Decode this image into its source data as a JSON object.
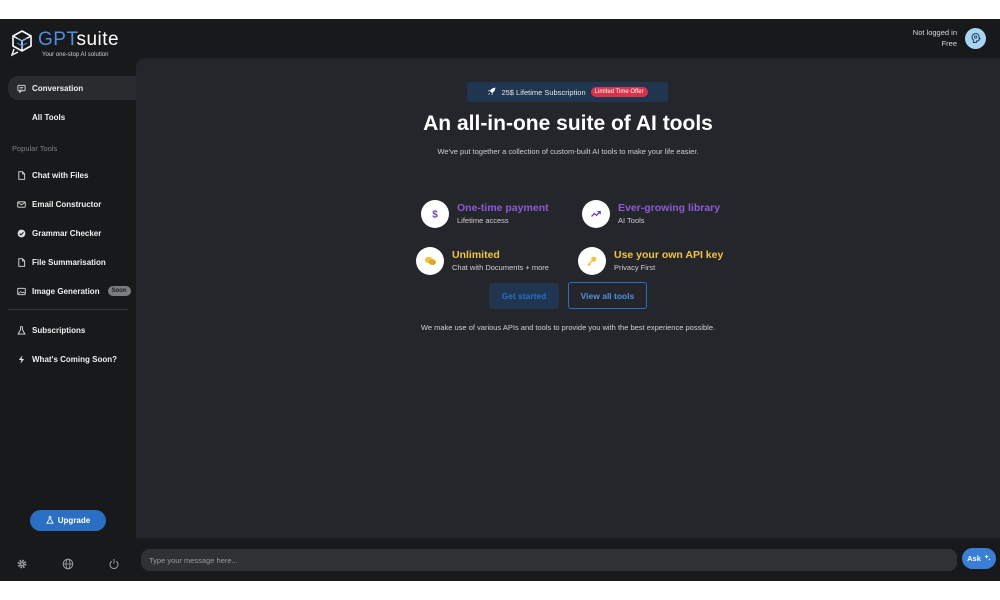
{
  "header": {
    "brand_part1": "GPT",
    "brand_part2": "suite",
    "tagline": "Your one-stop AI solution",
    "user_status": "Not logged in",
    "user_plan": "Free"
  },
  "sidebar": {
    "items": [
      {
        "label": "Conversation",
        "icon": "chat-icon",
        "active": true
      },
      {
        "label": "All Tools",
        "icon": "",
        "active": false
      }
    ],
    "section_label": "Popular Tools",
    "tools": [
      {
        "label": "Chat with Files",
        "icon": "file-icon"
      },
      {
        "label": "Email Constructor",
        "icon": "mail-icon"
      },
      {
        "label": "Grammar Checker",
        "icon": "check-circle-icon"
      },
      {
        "label": "File Summarisation",
        "icon": "file-icon"
      },
      {
        "label": "Image Generation",
        "icon": "image-icon",
        "badge": "Soon"
      }
    ],
    "extra": [
      {
        "label": "Subscriptions",
        "icon": "flask-icon"
      },
      {
        "label": "What's Coming Soon?",
        "icon": "bolt-icon"
      }
    ],
    "upgrade_label": "Upgrade",
    "bottom_icons": [
      "gear-icon",
      "globe-icon",
      "power-icon"
    ]
  },
  "main": {
    "promo_text": "25$ Lifetime Subscription",
    "promo_badge": "Limited Time Offer",
    "title": "An all-in-one suite of AI tools",
    "subtitle": "We've put together a collection of custom-built AI tools to make your life easier.",
    "features": [
      {
        "title": "One-time payment",
        "subtitle": "Lifetime access",
        "icon": "dollar-icon",
        "color": "#8b5cd6"
      },
      {
        "title": "Ever-growing library",
        "subtitle": "AI Tools",
        "icon": "trending-up-icon",
        "color": "#8b5cd6"
      },
      {
        "title": "Unlimited",
        "subtitle": "Chat with Documents + more",
        "icon": "chat-bubbles-icon",
        "color": "#f0c443"
      },
      {
        "title": "Use your own API key",
        "subtitle": "Privacy First",
        "icon": "key-icon",
        "color": "#f0c443"
      }
    ],
    "get_started_label": "Get started",
    "view_all_label": "View all tools",
    "footnote": "We make use of various APIs and tools to provide you with the best experience possible."
  },
  "composer": {
    "placeholder": "Type your message here...",
    "ask_label": "Ask"
  },
  "colors": {
    "accent": "#2a6fc4",
    "purple": "#8b5cd6",
    "yellow": "#f0c443",
    "badge_red": "#d9334b"
  }
}
